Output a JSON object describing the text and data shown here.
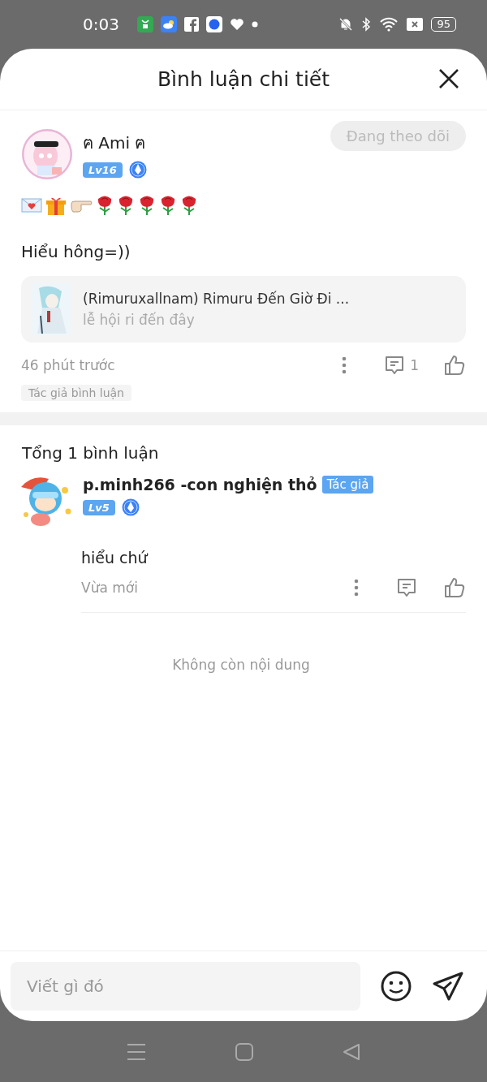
{
  "status_bar": {
    "time": "0:03",
    "battery": "95"
  },
  "sheet": {
    "title": "Bình luận chi tiết"
  },
  "main_comment": {
    "author": "ฅ Ami ฅ",
    "level_badge": "Lv16",
    "follow_button": "Đang theo dõi",
    "stickers": [
      {
        "kind": "envelope"
      },
      {
        "kind": "gift"
      },
      {
        "kind": "pointing-hand"
      },
      {
        "kind": "rose"
      },
      {
        "kind": "rose"
      },
      {
        "kind": "rose"
      },
      {
        "kind": "rose"
      },
      {
        "kind": "rose"
      }
    ],
    "text": "Hiểu hông=))",
    "story": {
      "title": "(Rimuruxallnam) Rimuru Đến Giờ Đi ...",
      "subtitle": "lễ hội ri đến đây"
    },
    "time": "46 phút trước",
    "reply_count": "1",
    "tag": "Tác giả bình luận"
  },
  "replies_header": "Tổng 1 bình luận",
  "replies": [
    {
      "author": "p.minh266 -con nghiện thỏ",
      "author_badge": "Tác giả",
      "level_badge": "Lv5",
      "text": "hiểu chứ",
      "time": "Vừa mới"
    }
  ],
  "end_note": "Không còn nội dung",
  "composer": {
    "placeholder": "Viết gì đó"
  }
}
